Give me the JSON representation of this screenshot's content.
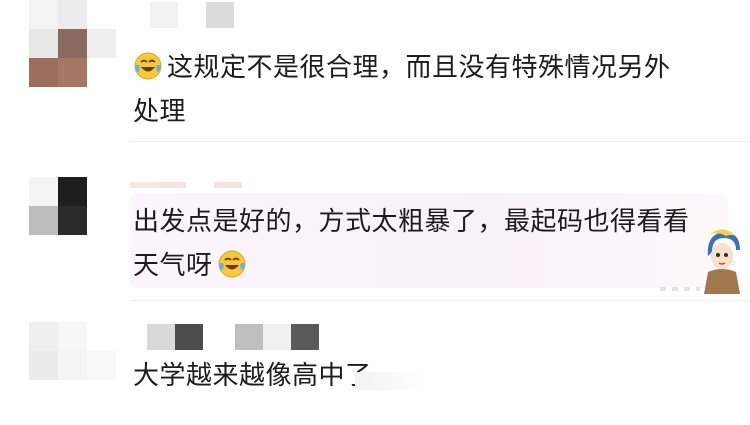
{
  "comments": [
    {
      "text_before_emoji": "",
      "text": "这规定不是很合理，而且没有特殊情况另外",
      "text_line2": "处理",
      "leading_emoji": "laughing-crying-emoji"
    },
    {
      "text": "出发点是好的，方式太粗暴了，最起码也得看看",
      "text_line2": "天气呀",
      "trailing_emoji": "laughing-crying-emoji"
    },
    {
      "text": "大学越来越像高中了"
    }
  ],
  "colors": {
    "text": "#1c1c1c",
    "divider": "#eeeeee",
    "highlight": "#f9f1f8"
  }
}
